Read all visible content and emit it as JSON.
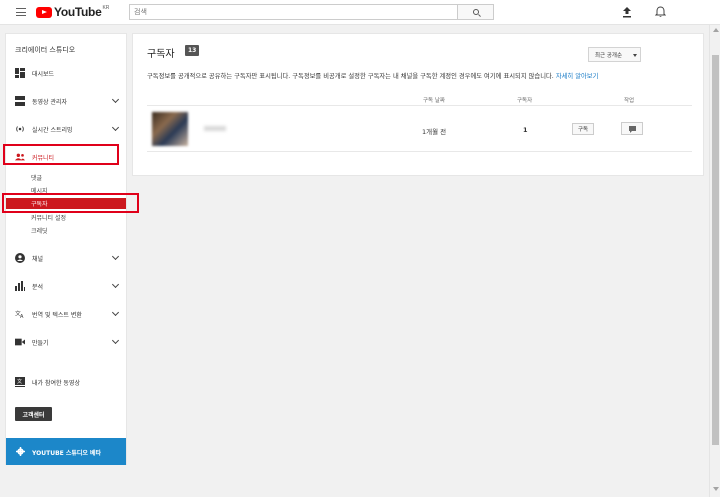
{
  "topbar": {
    "logo_text": "YouTube",
    "region": "KR",
    "search_placeholder": "검색"
  },
  "sidebar": {
    "title": "크리에이터 스튜디오",
    "items": [
      {
        "label": "대시보드",
        "icon": "dashboard-icon"
      },
      {
        "label": "동영상 관리자",
        "icon": "video-manager-icon"
      },
      {
        "label": "실시간 스트리밍",
        "icon": "live-streaming-icon"
      },
      {
        "label": "커뮤니티",
        "icon": "community-icon"
      }
    ],
    "community_sub": [
      "댓글",
      "메시지",
      "구독자",
      "커뮤니티 설정",
      "크레딧"
    ],
    "items2": [
      {
        "label": "채널",
        "icon": "channel-icon"
      },
      {
        "label": "분석",
        "icon": "analytics-icon"
      },
      {
        "label": "번역 및 텍스트 변환",
        "icon": "translate-icon"
      },
      {
        "label": "만들기",
        "icon": "create-icon"
      },
      {
        "label": "내가 참여한 동영상",
        "icon": "contributions-icon"
      }
    ],
    "support_label": "고객센터",
    "beta_label": "YOUTUBE 스튜디오 베타"
  },
  "main": {
    "title": "구독자",
    "count": "13",
    "sort_label": "최근 공개순",
    "notice_text": "구독정보를 공개적으로 공유하는 구독자만 표시됩니다. 구독정보를 비공개로 설정한 구독자는 내 채널을 구독한 계정인 경우에도 여기에 표시되지 않습니다.",
    "notice_link": "자세히 알아보기",
    "columns": [
      "구독 날짜",
      "구독자",
      "작업"
    ],
    "rows": [
      {
        "date": "1개월 전",
        "subscribers": "1",
        "subscribe_label": "구독"
      }
    ]
  },
  "colors": {
    "youtube_red": "#ff0000",
    "active_red": "#cc181e",
    "beta_blue": "#1c87c9",
    "link_blue": "#167ac6"
  }
}
